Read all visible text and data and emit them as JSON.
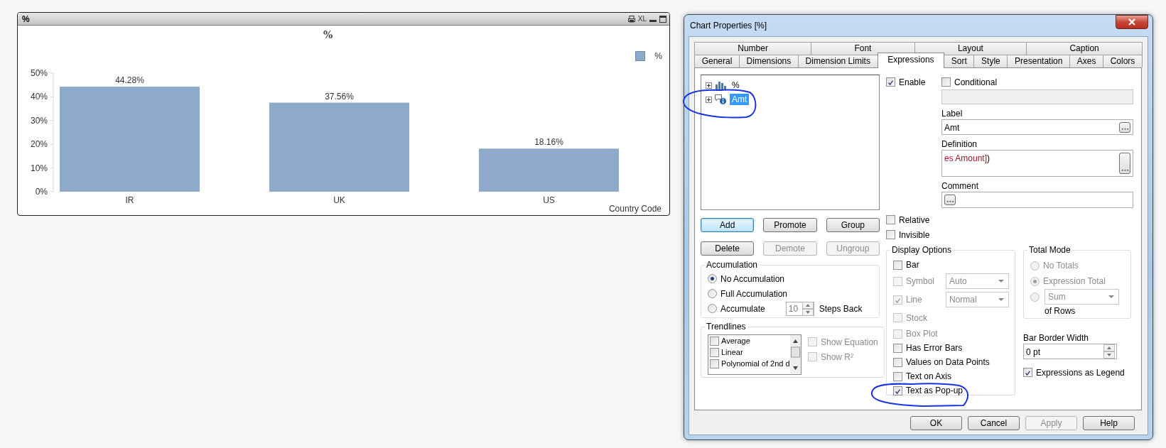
{
  "chart_window": {
    "caption": "%",
    "xl_button": "XL",
    "chart_data": {
      "type": "bar",
      "title": "%",
      "xlabel": "Country Code",
      "categories": [
        "IR",
        "UK",
        "US"
      ],
      "series": [
        {
          "name": "%",
          "color": "#8eaacb",
          "values": [
            44.28,
            37.56,
            18.16
          ]
        }
      ],
      "ylim": [
        0,
        50
      ],
      "yticks": [
        {
          "value": 0,
          "label": "0%"
        },
        {
          "value": 10,
          "label": "10%"
        },
        {
          "value": 20,
          "label": "20%"
        },
        {
          "value": 30,
          "label": "30%"
        },
        {
          "value": 40,
          "label": "40%"
        },
        {
          "value": 50,
          "label": "50%"
        }
      ],
      "value_labels": [
        "44.28%",
        "37.56%",
        "18.16%"
      ]
    }
  },
  "dialog": {
    "title": "Chart Properties [%]",
    "tab_rows": [
      [
        {
          "label": "Number",
          "selected": false
        },
        {
          "label": "Font",
          "selected": false
        },
        {
          "label": "Layout",
          "selected": false
        },
        {
          "label": "Caption",
          "selected": false
        }
      ],
      [
        {
          "label": "General",
          "selected": false
        },
        {
          "label": "Dimensions",
          "selected": false
        },
        {
          "label": "Dimension Limits",
          "selected": false
        },
        {
          "label": "Expressions",
          "selected": true
        },
        {
          "label": "Sort",
          "selected": false
        },
        {
          "label": "Style",
          "selected": false
        },
        {
          "label": "Presentation",
          "selected": false
        },
        {
          "label": "Axes",
          "selected": false
        },
        {
          "label": "Colors",
          "selected": false
        }
      ]
    ],
    "expression_tree": [
      {
        "label": "%",
        "kind": "bar",
        "selected": false
      },
      {
        "label": "Amt",
        "kind": "popup",
        "selected": true
      }
    ],
    "tree_buttons": [
      [
        {
          "label": "Add",
          "disabled": false,
          "focused": true
        },
        {
          "label": "Promote",
          "disabled": false,
          "focused": false
        },
        {
          "label": "Group",
          "disabled": false,
          "focused": false
        }
      ],
      [
        {
          "label": "Delete",
          "disabled": false,
          "focused": false
        },
        {
          "label": "Demote",
          "disabled": true,
          "focused": false
        },
        {
          "label": "Ungroup",
          "disabled": true,
          "focused": false
        }
      ]
    ],
    "enable": {
      "label": "Enable",
      "checked": true
    },
    "conditional": {
      "label": "Conditional",
      "checked": false
    },
    "label_field": {
      "caption": "Label",
      "value": "Amt"
    },
    "definition_field": {
      "caption": "Definition",
      "parts": [
        {
          "text": "es Amount]",
          "kind": "field_name"
        },
        {
          "text": ")",
          "kind": "plain"
        }
      ]
    },
    "comment_field": {
      "caption": "Comment"
    },
    "relative": {
      "label": "Relative",
      "checked": false
    },
    "invisible": {
      "label": "Invisible",
      "checked": false
    },
    "accumulation": {
      "title": "Accumulation",
      "options": [
        {
          "label": "No Accumulation",
          "selected": true
        },
        {
          "label": "Full Accumulation",
          "selected": false
        },
        {
          "label": "Accumulate",
          "selected": false
        }
      ],
      "steps_value": "10",
      "steps_label": "Steps Back"
    },
    "trendlines": {
      "title": "Trendlines",
      "items": [
        {
          "label": "Average",
          "checked": false
        },
        {
          "label": "Linear",
          "checked": false
        },
        {
          "label": "Polynomial of 2nd d",
          "checked": false
        }
      ],
      "options": [
        {
          "label": "Show Equation",
          "checked": false,
          "disabled": true
        },
        {
          "label": "Show R²",
          "checked": false,
          "disabled": true
        }
      ]
    },
    "display_options": {
      "title": "Display Options",
      "items": [
        {
          "label": "Bar",
          "checked": false,
          "disabled": false
        },
        {
          "label": "Symbol",
          "checked": false,
          "disabled": true,
          "dropdown": "Auto"
        },
        {
          "label": "Line",
          "checked": true,
          "disabled": true,
          "dropdown": "Normal"
        },
        {
          "label": "Stock",
          "checked": false,
          "disabled": true
        },
        {
          "label": "Box Plot",
          "checked": false,
          "disabled": true
        },
        {
          "label": "Has Error Bars",
          "checked": false,
          "disabled": false
        },
        {
          "label": "Values on Data Points",
          "checked": false,
          "disabled": false
        },
        {
          "label": "Text on Axis",
          "checked": false,
          "disabled": false
        },
        {
          "label": "Text as Pop-up",
          "checked": true,
          "disabled": false
        }
      ]
    },
    "total_mode": {
      "title": "Total Mode",
      "options": [
        {
          "label": "No Totals",
          "selected": false
        },
        {
          "label": "Expression Total",
          "selected": true
        }
      ],
      "sum_selected": false,
      "sum_dropdown": "Sum",
      "sum_suffix": "of Rows",
      "disabled": true
    },
    "bar_border_width": {
      "label": "Bar Border Width",
      "value": "0 pt"
    },
    "expressions_as_legend": {
      "label": "Expressions as Legend",
      "checked": true
    },
    "footer_buttons": [
      {
        "label": "OK",
        "disabled": false
      },
      {
        "label": "Cancel",
        "disabled": false
      },
      {
        "label": "Apply",
        "disabled": true
      },
      {
        "label": "Help",
        "disabled": false
      }
    ]
  }
}
